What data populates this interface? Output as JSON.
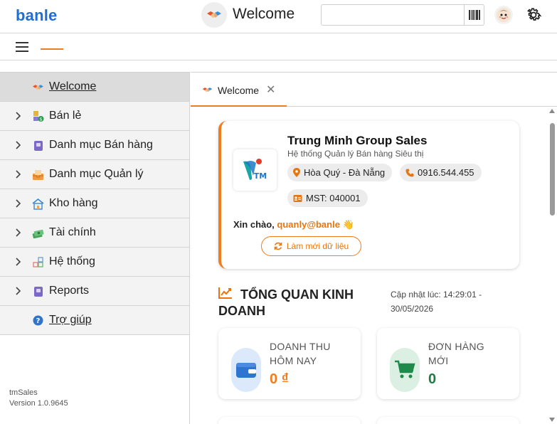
{
  "header": {
    "brand": "banle",
    "title": "Welcome",
    "search": {
      "value": "",
      "placeholder": ""
    }
  },
  "sidebar": {
    "items": [
      {
        "label": "Welcome",
        "icon": "handshake-icon",
        "expandable": false,
        "active": true
      },
      {
        "label": "Bán lẻ",
        "icon": "retail-icon",
        "expandable": true
      },
      {
        "label": "Danh mục Bán hàng",
        "icon": "book-icon",
        "expandable": true
      },
      {
        "label": "Danh mục Quản lý",
        "icon": "inbox-icon",
        "expandable": true
      },
      {
        "label": "Kho hàng",
        "icon": "warehouse-icon",
        "expandable": true
      },
      {
        "label": "Tài chính",
        "icon": "money-icon",
        "expandable": true
      },
      {
        "label": "Hệ thống",
        "icon": "blocks-icon",
        "expandable": true
      },
      {
        "label": "Reports",
        "icon": "report-icon",
        "expandable": true
      },
      {
        "label": "Trợ giúp",
        "icon": "help-icon",
        "expandable": false
      }
    ],
    "app_name": "tmSales",
    "version": "Version 1.0.9645"
  },
  "tabs": [
    {
      "label": "Welcome",
      "icon": "handshake-icon",
      "closable": true,
      "active": true
    }
  ],
  "company": {
    "name": "Trung Minh Group Sales",
    "subtitle": "Hệ thống Quản lý Bán hàng Siêu thị",
    "location": "Hòa Quý - Đà Nẵng",
    "phone": "0916.544.455",
    "tax_id": "MST: 040001",
    "greeting_prefix": "Xin chào,",
    "user": "quanly@banle",
    "refresh_label": "Làm mới dữ liệu"
  },
  "overview": {
    "title": "TỔNG QUAN KINH DOANH",
    "updated_text": "Cập nhật lúc: 14:29:01 - 30/05/2026"
  },
  "stats": [
    {
      "label": "DOANH THU HÔM NAY",
      "value": "0 ₫",
      "color": "#f07c1e",
      "icon": "wallet-icon"
    },
    {
      "label": "ĐƠN HÀNG MỚI",
      "value": "0",
      "color": "#1e7d45",
      "icon": "cart-icon"
    }
  ],
  "colors": {
    "brand": "#1f6fd1",
    "accent": "#f07c1e",
    "success": "#1e7d45"
  }
}
